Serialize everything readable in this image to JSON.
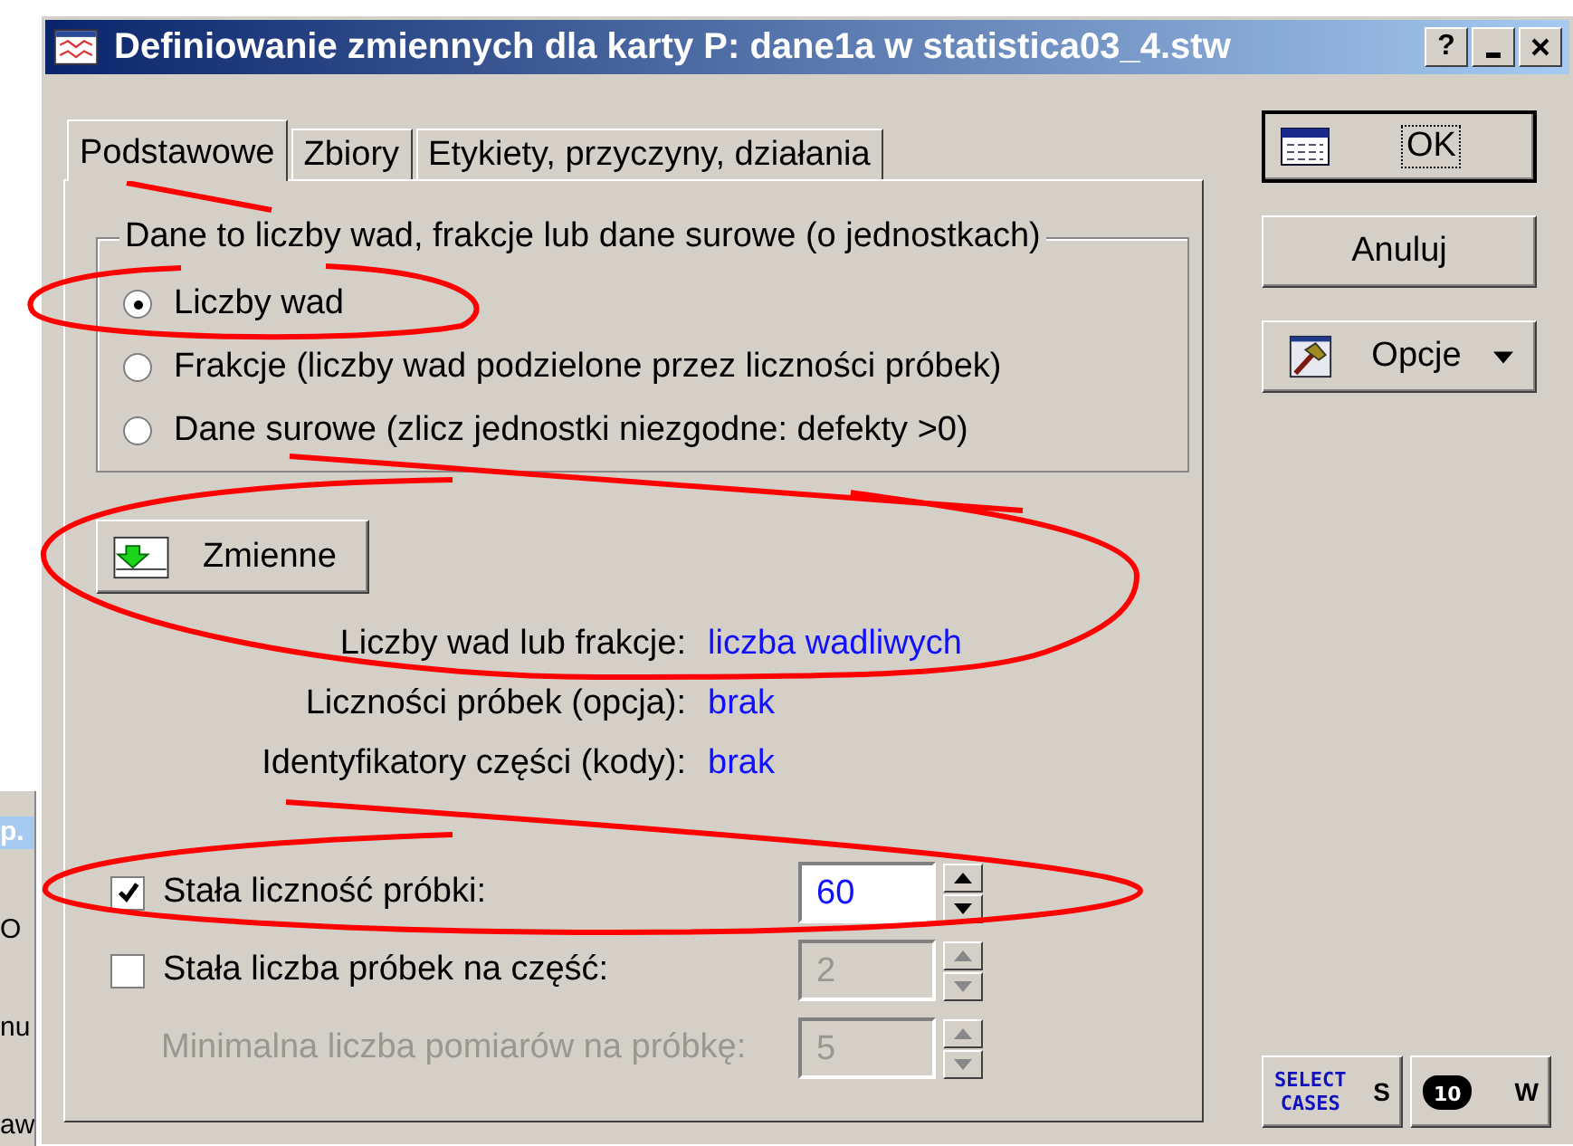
{
  "window": {
    "title": "Definiowanie zmiennych dla karty P: dane1a w statistica03_4.stw",
    "help_button": "?"
  },
  "tabs": [
    {
      "label": "Podstawowe",
      "selected": true
    },
    {
      "label": "Zbiory",
      "selected": false
    },
    {
      "label": "Etykiety, przyczyny, działania",
      "selected": false
    }
  ],
  "data_group": {
    "legend": "Dane to liczby wad, frakcje lub dane surowe (o jednostkach)",
    "options": [
      {
        "label": "Liczby wad",
        "selected": true
      },
      {
        "label": "Frakcje (liczby wad podzielone przez liczności próbek)",
        "selected": false
      },
      {
        "label": "Dane surowe (zlicz jednostki niezgodne: defekty >0)",
        "selected": false
      }
    ]
  },
  "variables_button": "Zmienne",
  "assignments": [
    {
      "label": "Liczby wad lub frakcje:",
      "value": "liczba wadliwych"
    },
    {
      "label": "Liczności próbek (opcja):",
      "value": "brak"
    },
    {
      "label": "Identyfikatory części (kody):",
      "value": "brak"
    }
  ],
  "settings": [
    {
      "kind": "checkbox",
      "label": "Stała liczność próbki:",
      "checked": true,
      "value": "60",
      "disabled": false
    },
    {
      "kind": "checkbox",
      "label": "Stała liczba próbek na część:",
      "checked": false,
      "value": "2",
      "disabled": true
    },
    {
      "kind": "label",
      "label": "Minimalna liczba pomiarów na próbkę:",
      "value": "5",
      "disabled": true
    }
  ],
  "buttons": {
    "ok": "OK",
    "cancel": "Anuluj",
    "options": "Opcje"
  },
  "select_cases_button": {
    "icon_lines": [
      "SELECT",
      "CASES"
    ],
    "key": "S"
  },
  "weight_button": {
    "icon_text": "10",
    "key": "W"
  },
  "background_window": {
    "texts": [
      "p.",
      "O",
      "nu",
      "aw"
    ]
  }
}
